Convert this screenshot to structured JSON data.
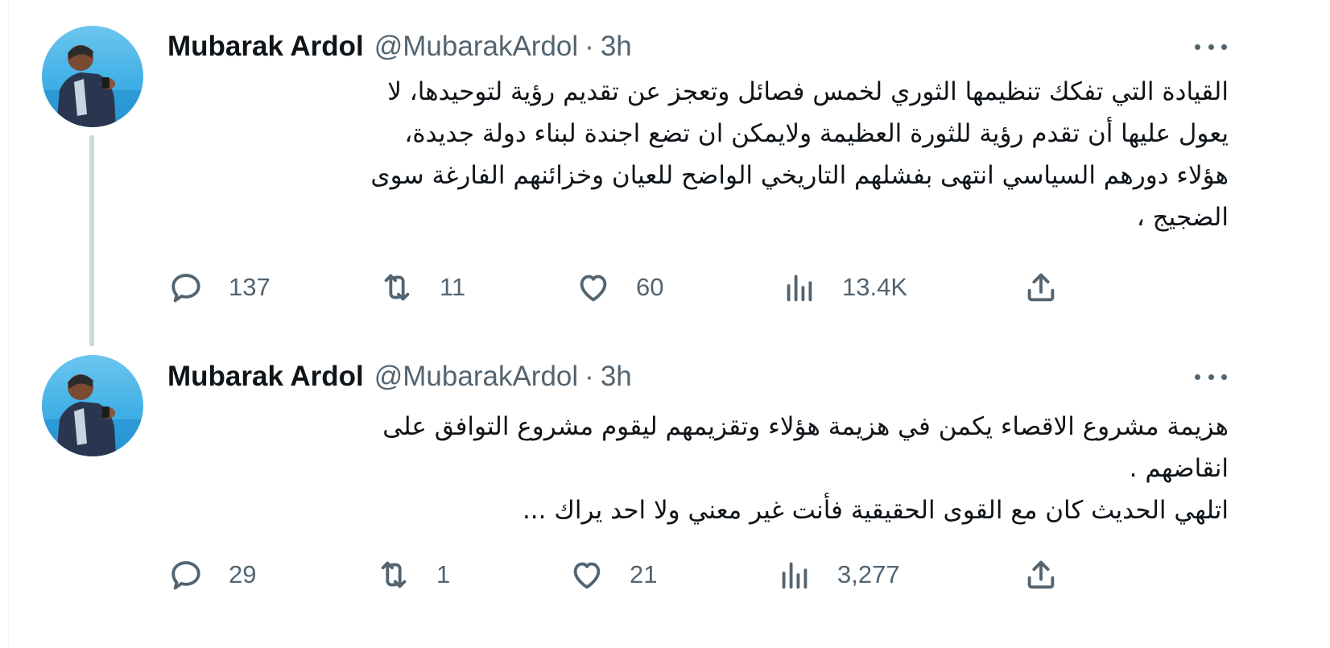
{
  "tweets": [
    {
      "author_name": "Mubarak Ardol",
      "handle": "@MubarakArdol",
      "separator": "·",
      "time": "3h",
      "text": "القيادة التي تفكك تنظيمها الثوري لخمس فصائل وتعجز عن تقديم رؤية لتوحيدها، لا\nيعول عليها أن تقدم رؤية للثورة العظيمة ولايمكن ان تضع اجندة لبناء دولة جديدة،\nهؤلاء دورهم السياسي انتهى بفشلهم التاريخي الواضح للعيان وخزائنهم الفارغة سوى\nالضجيج ،",
      "replies": "137",
      "retweets": "11",
      "likes": "60",
      "views": "13.4K"
    },
    {
      "author_name": "Mubarak Ardol",
      "handle": "@MubarakArdol",
      "separator": "·",
      "time": "3h",
      "text": "هزيمة مشروع الاقصاء يكمن في هزيمة هؤلاء وتقزيمهم ليقوم مشروع التوافق على\nانقاضهم .\nاتلهي الحديث كان مع القوى الحقيقية فأنت غير معني ولا احد يراك ...",
      "replies": "29",
      "retweets": "1",
      "likes": "21",
      "views": "3,277"
    }
  ],
  "icons": {
    "reply": "speech-bubble",
    "retweet": "two-arrows-loop",
    "like": "heart",
    "views": "bar-chart",
    "share": "upload-arrow",
    "more": "three-dots"
  },
  "colors": {
    "text_primary": "#0f1419",
    "text_secondary": "#536471",
    "thread_line": "#cfd9de",
    "avatar_sky": "#41b0e6"
  }
}
